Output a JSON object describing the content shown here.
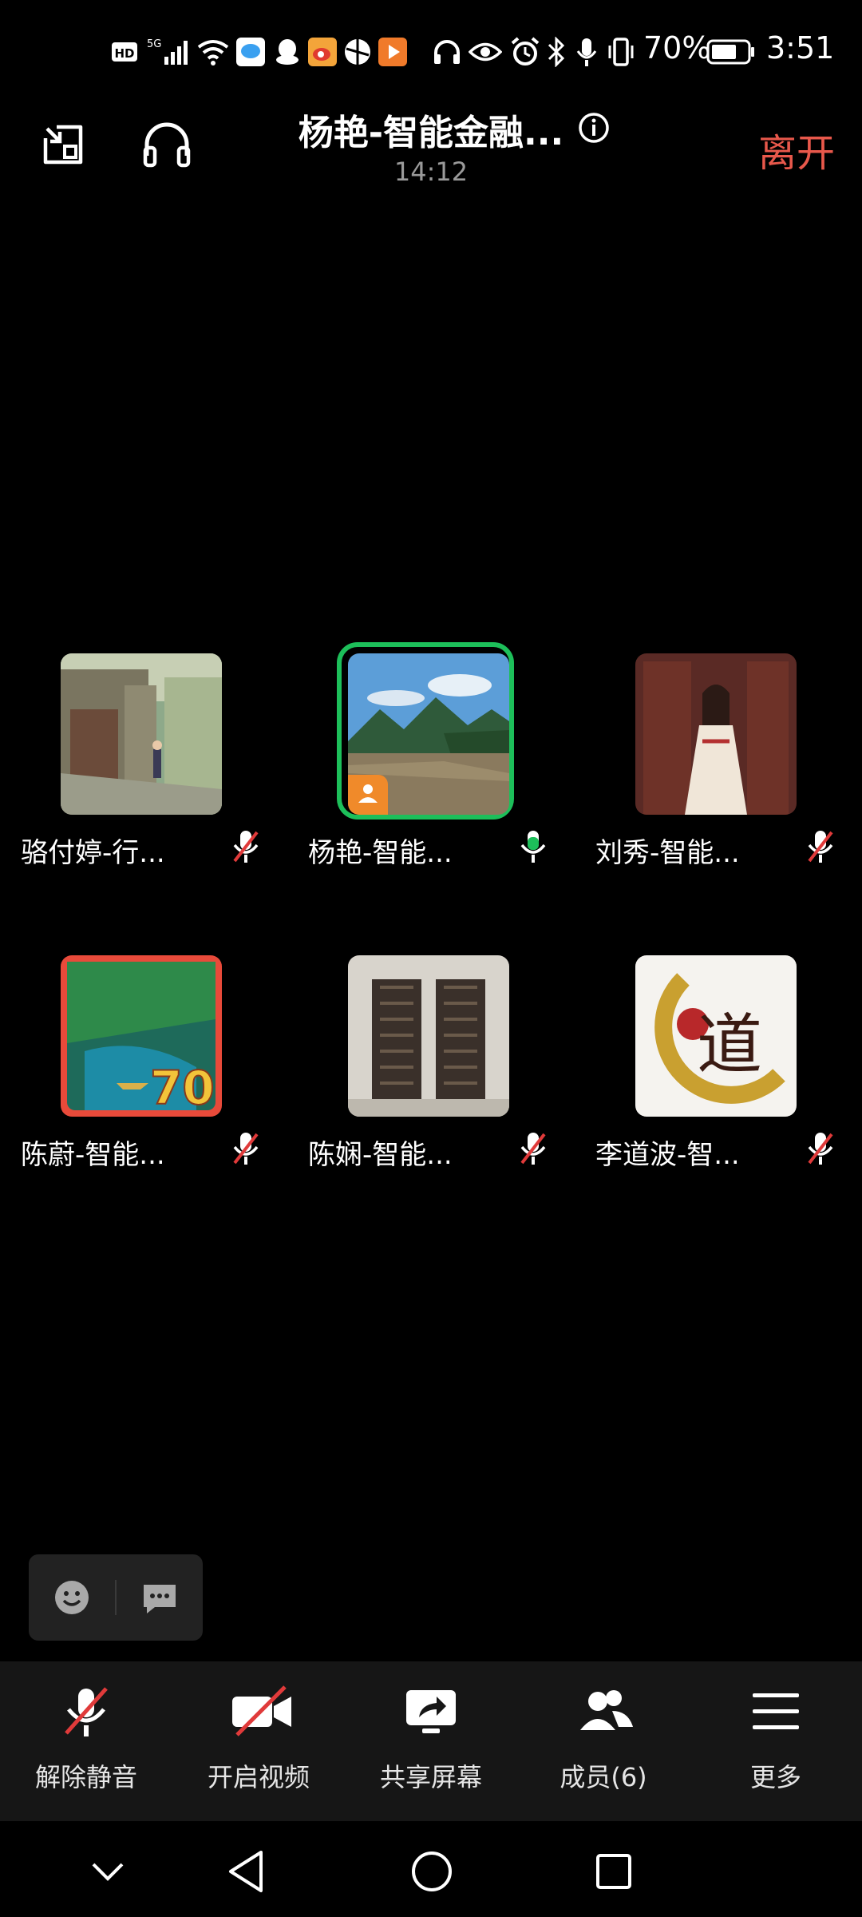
{
  "status_bar": {
    "battery_text": "70%",
    "time": "3:51",
    "icons": [
      "hd-icon",
      "5g-signal-icon",
      "wifi-icon",
      "chat-app-icon",
      "qq-icon",
      "weibo-icon",
      "browser-icon",
      "video-app-icon",
      "headphone-status-icon",
      "eye-icon",
      "alarm-icon",
      "bluetooth-icon",
      "mic-status-icon",
      "vibrate-icon",
      "battery-icon"
    ]
  },
  "header": {
    "title": "杨艳-智能金融...",
    "duration": "14:12",
    "leave_label": "离开"
  },
  "participants": [
    {
      "name": "骆付婷-行...",
      "muted": true,
      "speaking": false,
      "host": false,
      "avatar_desc": "street-scene-avatar"
    },
    {
      "name": "杨艳-智能...",
      "muted": false,
      "speaking": true,
      "host": true,
      "avatar_desc": "mountain-river-avatar"
    },
    {
      "name": "刘秀-智能...",
      "muted": true,
      "speaking": false,
      "host": false,
      "avatar_desc": "woman-hanfu-avatar"
    },
    {
      "name": "陈蔚-智能...",
      "muted": true,
      "speaking": false,
      "host": false,
      "avatar_desc": "forest-boat-avatar"
    },
    {
      "name": "陈娴-智能...",
      "muted": true,
      "speaking": false,
      "host": false,
      "avatar_desc": "building-windows-avatar"
    },
    {
      "name": "李道波-智...",
      "muted": true,
      "speaking": false,
      "host": false,
      "avatar_desc": "dao-calligraphy-avatar"
    }
  ],
  "avatar_badge_text": {
    "forest": "70",
    "dao": "道"
  },
  "toolbar": {
    "unmute_label": "解除静音",
    "video_label": "开启视频",
    "share_label": "共享屏幕",
    "members_label": "成员(6)",
    "more_label": "更多"
  },
  "colors": {
    "accent_leave": "#e8584b",
    "speaking_ring": "#1dbf5a",
    "mute_slash": "#e03a3a",
    "host_badge": "#f08a2a"
  }
}
